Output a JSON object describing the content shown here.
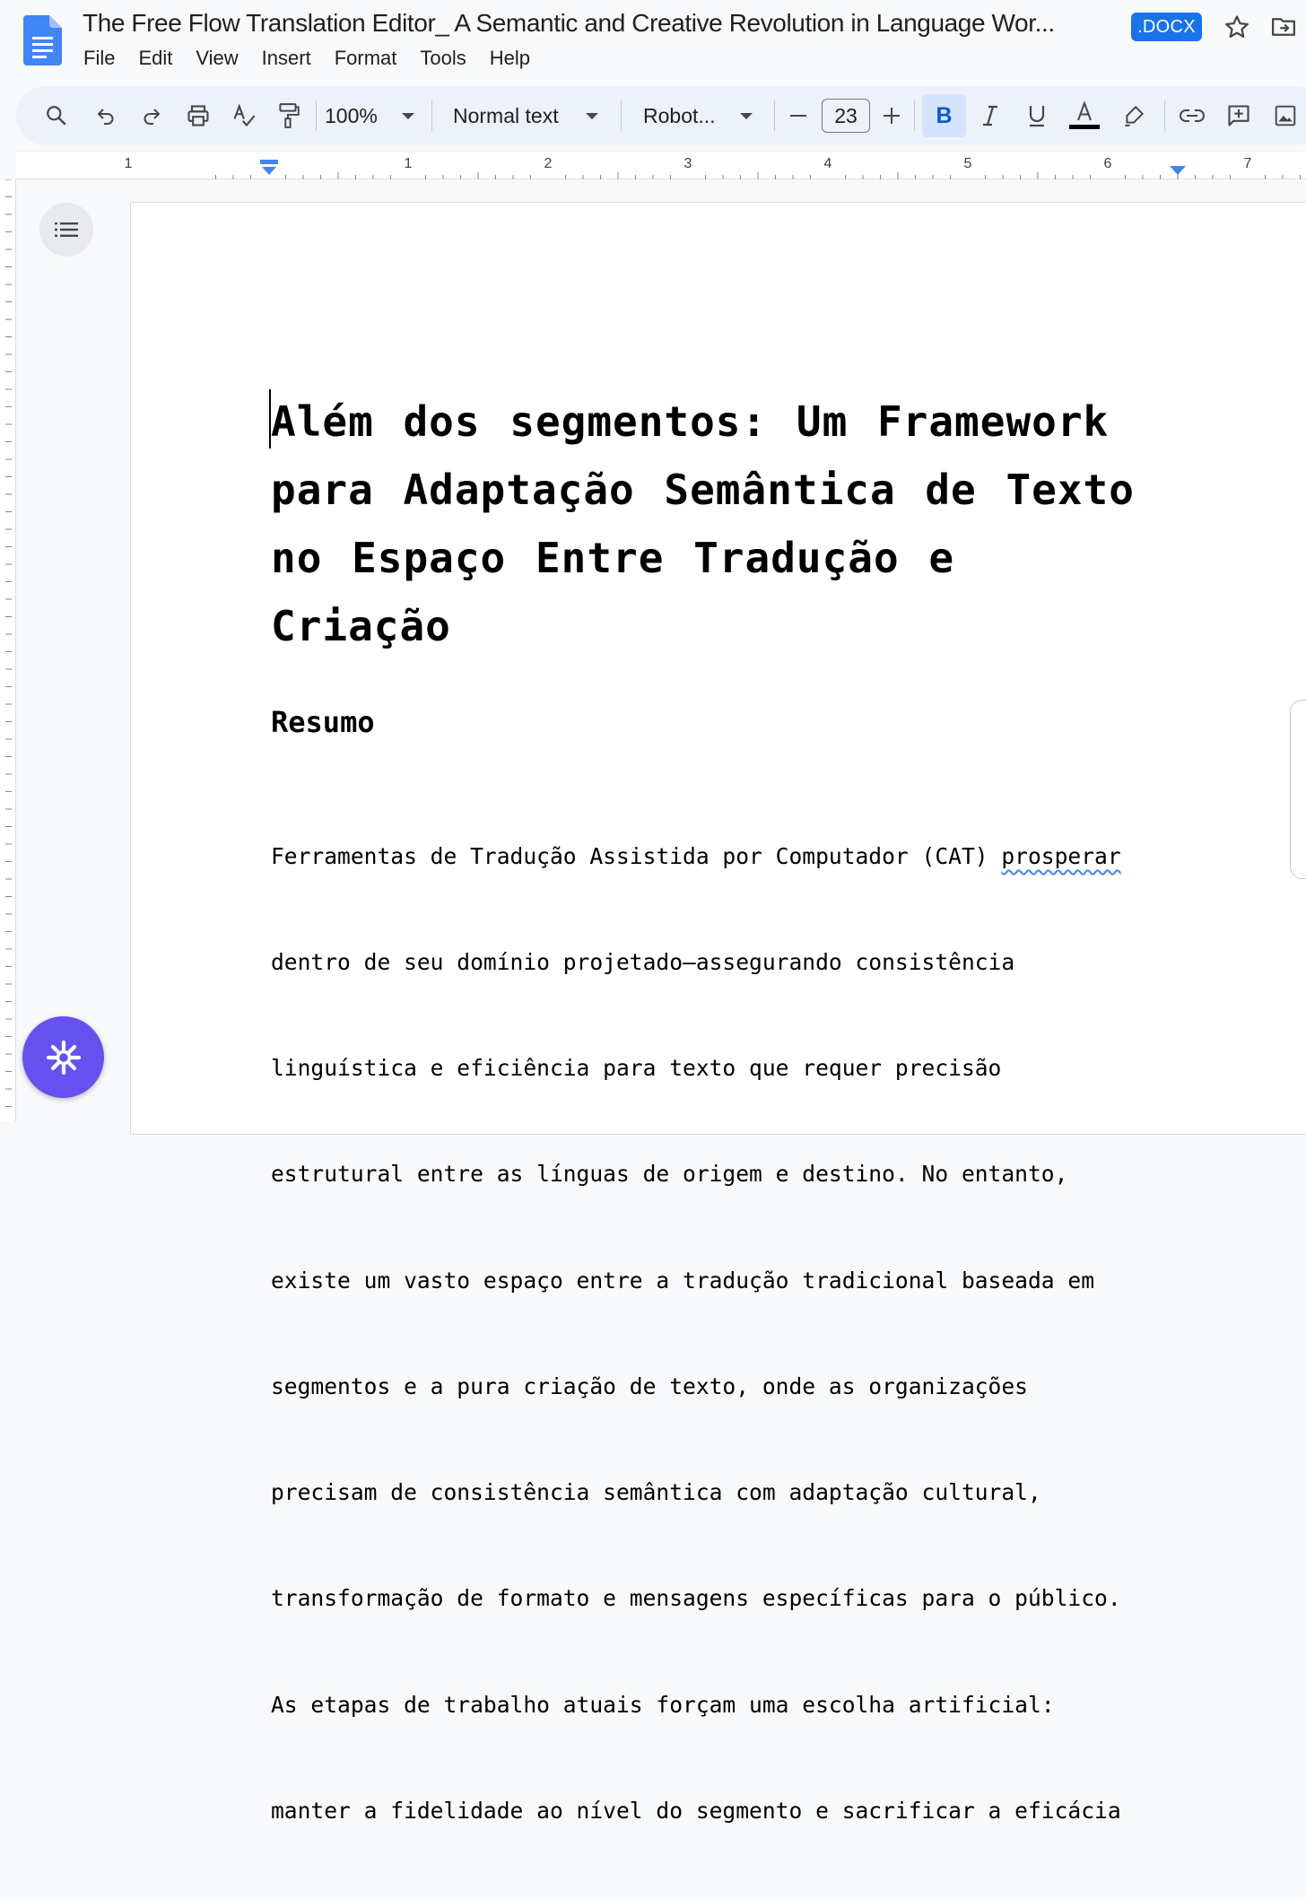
{
  "app": {
    "doc_title": "The Free Flow Translation Editor_ A Semantic and Creative Revolution in Language Wor...",
    "file_badge": ".DOCX",
    "icons": {
      "logo": "google-docs-logo-icon",
      "star": "star-icon",
      "move": "move-to-folder-icon"
    },
    "accent": "#1a73e8"
  },
  "menu": [
    "File",
    "Edit",
    "View",
    "Insert",
    "Format",
    "Tools",
    "Help"
  ],
  "toolbar": {
    "zoom": "100%",
    "style": "Normal text",
    "font": "Robot...",
    "font_size": "23",
    "bold_active": true,
    "icons": [
      "search-icon",
      "undo-icon",
      "redo-icon",
      "print-icon",
      "spellcheck-icon",
      "paint-format-icon",
      "decrease-font-icon",
      "increase-font-icon",
      "bold-icon",
      "italic-icon",
      "underline-icon",
      "text-color-icon",
      "highlight-icon",
      "link-icon",
      "add-comment-icon",
      "insert-image-icon"
    ]
  },
  "ruler": {
    "labels": [
      "1",
      "1",
      "2",
      "3",
      "4",
      "5",
      "6",
      "7"
    ]
  },
  "document": {
    "title_lines": [
      "Além dos segmentos: Um Framework",
      "para Adaptação Semântica de Texto",
      "no Espaço Entre Tradução e",
      "Criação"
    ],
    "heading": "Resumo",
    "body_first_line_pre": "Ferramentas de Tradução Assistida por Computador (CAT) ",
    "body_misspelled": "prosperar",
    "body_lines": [
      "dentro de seu domínio projetado—assegurando consistência",
      "linguística e eficiência para texto que requer precisão",
      "estrutural entre as línguas de origem e destino. No entanto,",
      "existe um vasto espaço entre a tradução tradicional baseada em",
      "segmentos e a pura criação de texto, onde as organizações",
      "precisam de consistência semântica com adaptação cultural,",
      "transformação de formato e mensagens específicas para o público.",
      "As etapas de trabalho atuais forçam uma escolha artificial:",
      "manter a fidelidade ao nível do segmento e sacrificar a eficácia"
    ]
  }
}
